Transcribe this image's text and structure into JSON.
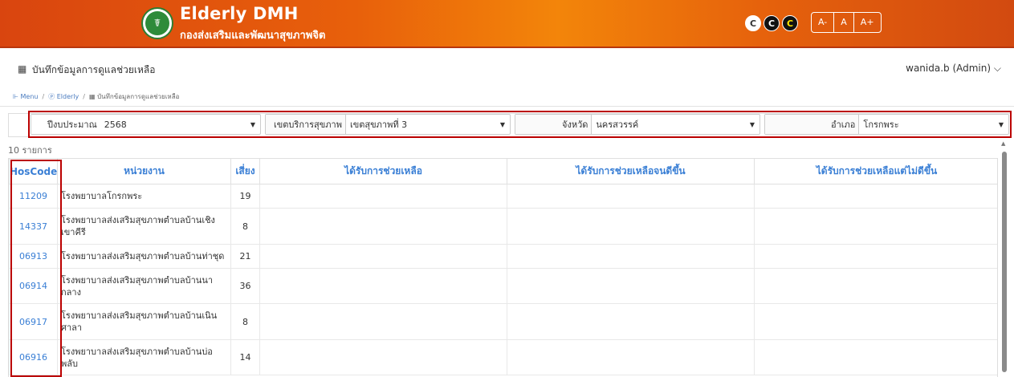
{
  "header": {
    "brand_title": "Elderly DMH",
    "brand_subtitle": "กองส่งเสริมและพัฒนาสุขภาพจิต",
    "contrast_buttons": [
      "C",
      "C",
      "C"
    ],
    "font_buttons": [
      "A-",
      "A",
      "A+"
    ],
    "colors": {
      "bar_start": "#d9450f",
      "bar_mid": "#f3850a",
      "bar_end": "#d24a10"
    }
  },
  "subbar": {
    "icon": "form-icon",
    "page_title": "บันทึกข้อมูลการดูแลช่วยเหลือ",
    "user": "wanida.b (Admin)"
  },
  "breadcrumb": {
    "items": [
      "Menu",
      "Elderly",
      "บันทึกข้อมูลการดูแลช่วยเหลือ"
    ],
    "separator": "/"
  },
  "filters": {
    "year": {
      "label": "ปีงบประมาณ",
      "value": "2568"
    },
    "region": {
      "label": "เขตบริการสุขภาพ",
      "value": "เขตสุขภาพที่ 3"
    },
    "province": {
      "label": "จังหวัด",
      "value": "นครสวรรค์"
    },
    "district": {
      "label": "อำเภอ",
      "value": "โกรกพระ"
    }
  },
  "count_text": "10 รายการ",
  "table": {
    "headers": [
      "HosCode",
      "หน่วยงาน",
      "เสี่ยง",
      "ได้รับการช่วยเหลือ",
      "ได้รับการช่วยเหลือจนดีขึ้น",
      "ได้รับการช่วยเหลือแต่ไม่ดีขึ้น"
    ],
    "rows": [
      {
        "code": "11209",
        "unit": "โรงพยาบาลโกรกพระ",
        "risk": "19",
        "helped": "",
        "improved": "",
        "not_improved": ""
      },
      {
        "code": "14337",
        "unit": "โรงพยาบาลส่งเสริมสุขภาพตำบลบ้านเชิงเขาคีรี",
        "risk": "8",
        "helped": "",
        "improved": "",
        "not_improved": ""
      },
      {
        "code": "06913",
        "unit": "โรงพยาบาลส่งเสริมสุขภาพตำบลบ้านท่าชุด",
        "risk": "21",
        "helped": "",
        "improved": "",
        "not_improved": ""
      },
      {
        "code": "06914",
        "unit": "โรงพยาบาลส่งเสริมสุขภาพตำบลบ้านนากลาง",
        "risk": "36",
        "helped": "",
        "improved": "",
        "not_improved": ""
      },
      {
        "code": "06917",
        "unit": "โรงพยาบาลส่งเสริมสุขภาพตำบลบ้านเนินศาลา",
        "risk": "8",
        "helped": "",
        "improved": "",
        "not_improved": ""
      },
      {
        "code": "06916",
        "unit": "โรงพยาบาลส่งเสริมสุขภาพตำบลบ้านบ่อพลับ",
        "risk": "14",
        "helped": "",
        "improved": "",
        "not_improved": ""
      }
    ]
  },
  "accent_colors": {
    "link": "#3a7fd5",
    "highlight_border": "#bb0000"
  }
}
